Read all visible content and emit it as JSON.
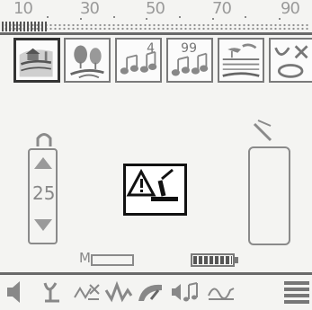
{
  "scale": {
    "ticks": [
      "10",
      "30",
      "50",
      "70",
      "90"
    ],
    "level_percent": 15
  },
  "modes": [
    {
      "name": "Park",
      "icon": "park-icon"
    },
    {
      "name": "Field",
      "icon": "field-icon"
    },
    {
      "name": "4 tones",
      "icon": "music-4-icon",
      "badge": "4"
    },
    {
      "name": "99 tones",
      "icon": "music-99-icon",
      "badge": "99"
    },
    {
      "name": "Beach",
      "icon": "beach-icon"
    },
    {
      "name": "Gold",
      "icon": "gold-icon"
    }
  ],
  "selected_mode": 0,
  "sensitivity": {
    "value": "25"
  },
  "memory": {
    "label": "M",
    "fill_percent": 0
  },
  "battery": {
    "level_percent": 100
  },
  "warning_icon": "coil-warning-icon",
  "menu": [
    {
      "icon": "volume-icon"
    },
    {
      "icon": "iron-discrimination-icon"
    },
    {
      "icon": "ground-balance-icon"
    },
    {
      "icon": "frequency-icon"
    },
    {
      "icon": "sensitivity-gauge-icon"
    },
    {
      "icon": "tone-volume-icon"
    },
    {
      "icon": "threshold-icon"
    },
    {
      "icon": "menu-icon"
    }
  ],
  "colors": {
    "lcd_background": "#f4f4f2",
    "segment_dark": "#333333",
    "segment_gray": "#8a8a8a"
  }
}
